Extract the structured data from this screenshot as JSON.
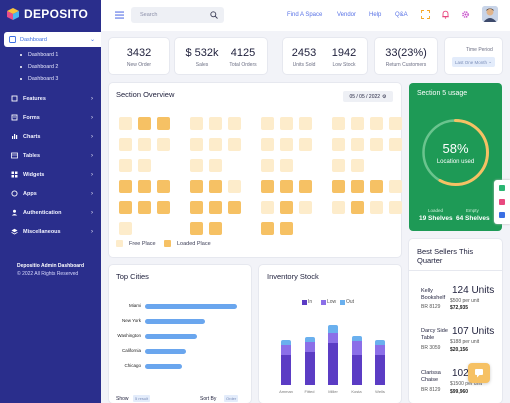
{
  "brand": {
    "name": "DEPOSITO"
  },
  "sidebar": {
    "active": {
      "label": "Dashboard"
    },
    "sub_items": [
      {
        "label": "Dashboard 1"
      },
      {
        "label": "Dashboard 2"
      },
      {
        "label": "Dashboard 3"
      }
    ],
    "items": [
      {
        "label": "Features"
      },
      {
        "label": "Forms"
      },
      {
        "label": "Charts"
      },
      {
        "label": "Tables"
      },
      {
        "label": "Widgets"
      },
      {
        "label": "Apps"
      },
      {
        "label": "Authentication"
      },
      {
        "label": "Miscellaneous"
      }
    ],
    "footer": {
      "title": "Depositio Admin Dashboard",
      "copyright": "© 2022 All Rights Reserved"
    }
  },
  "topbar": {
    "search_placeholder": "Search",
    "links": [
      "Find A Space",
      "Vendor",
      "Help",
      "Q&A"
    ]
  },
  "stats": [
    {
      "value": "3432",
      "label": "New Order"
    },
    {
      "value": "$ 532k",
      "label": "Sales"
    },
    {
      "value": "4125",
      "label": "Total Orders"
    },
    {
      "value": "2453",
      "label": "Units Sold"
    },
    {
      "value": "1942",
      "label": "Low Stock"
    },
    {
      "value": "33(23%)",
      "label": "Return Customers"
    }
  ],
  "time_period": {
    "label": "Time Period",
    "value": "Last One Month"
  },
  "section_overview": {
    "title": "Section Overview",
    "date": "05 / 05 / 2022",
    "legend_free": "Free Place",
    "legend_loaded": "Loaded Place"
  },
  "section_usage": {
    "title": "Section 5 usage",
    "percent": "58%",
    "percent_value": 58,
    "caption": "Location used",
    "loaded_label": "Loaded",
    "empty_label": "Empty",
    "loaded_value": "19 Shelves",
    "empty_value": "64 Shelves",
    "colors": {
      "track": "#6ac48e",
      "progress": "#f6c164"
    }
  },
  "top_cities": {
    "title": "Top Cities",
    "show_label": "Show",
    "show_value": "5 result",
    "sort_label": "Sort By",
    "sort_value": "Order",
    "chart_data": {
      "type": "bar",
      "orientation": "horizontal",
      "categories": [
        "Miami",
        "New York",
        "Washington",
        "California",
        "Chicago"
      ],
      "values": [
        100,
        65,
        56,
        45,
        40
      ]
    }
  },
  "inventory": {
    "title": "Inventory Stock",
    "chart_data": {
      "type": "bar",
      "stacked": true,
      "categories": [
        "Amman",
        "Fitted",
        "Miller",
        "Kosta",
        "Wells"
      ],
      "series": [
        {
          "name": "In",
          "color": "#5b3cc4",
          "values": [
            30,
            33,
            42,
            30,
            30
          ]
        },
        {
          "name": "Low",
          "color": "#8b6fe8",
          "values": [
            10,
            10,
            10,
            14,
            10
          ]
        },
        {
          "name": "Out",
          "color": "#6ab0ee",
          "values": [
            5,
            5,
            8,
            5,
            5
          ]
        }
      ],
      "ylim": [
        0,
        60
      ]
    }
  },
  "best_sellers": {
    "title": "Best Sellers This Quarter",
    "items": [
      {
        "name1": "Kelly",
        "name2": "Bookshelf",
        "code": "BR 8129",
        "units": "124 Units",
        "price": "$500 per unit",
        "total": "$72,935"
      },
      {
        "name1": "Darcy Side",
        "name2": "Table",
        "code": "BR 3059",
        "units": "107 Units",
        "price": "$188 per unit",
        "total": "$20,156"
      },
      {
        "name1": "Clarissa",
        "name2": "Chaise",
        "code": "BR 8129",
        "units": "102",
        "price": "$1500 per unit",
        "total": "$99,960"
      }
    ]
  }
}
